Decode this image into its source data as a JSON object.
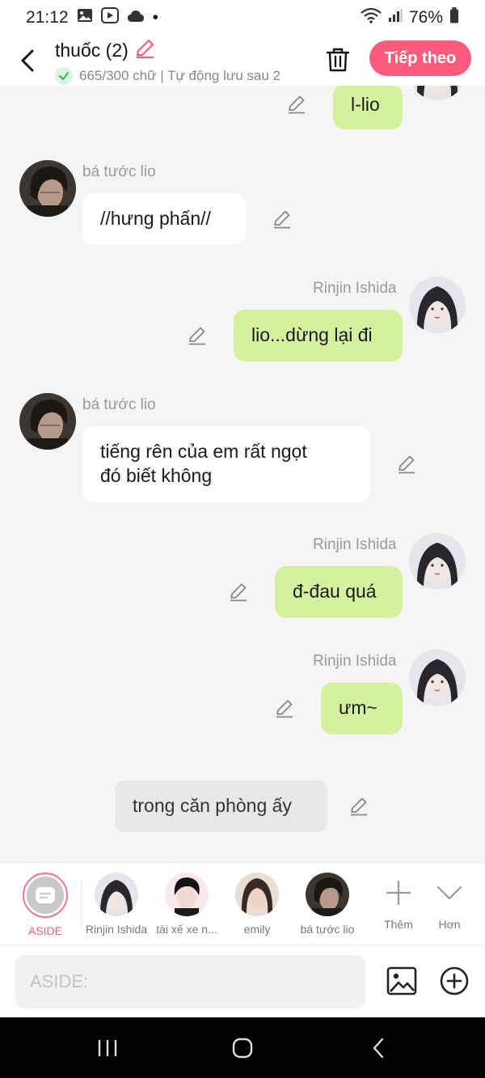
{
  "status_bar": {
    "time": "21:12",
    "dot": "•",
    "battery": "76%",
    "icons": [
      "gallery-icon",
      "video-icon",
      "cloud-icon",
      "wifi-icon",
      "signal-icon",
      "battery-icon"
    ]
  },
  "header": {
    "title": "thuốc (2)",
    "subtitle": "665/300 chữ | Tự động lưu sau 2",
    "next_label": "Tiếp theo",
    "accent": "#ff5b7d"
  },
  "chat": {
    "messages": [
      {
        "side": "right",
        "sender": "",
        "text": "l-lio"
      },
      {
        "side": "left",
        "sender": "bá tước lio",
        "text": "//hưng phấn//"
      },
      {
        "side": "right",
        "sender": "Rinjin Ishida",
        "text": "lio...dừng lại đi"
      },
      {
        "side": "left",
        "sender": "bá tước lio",
        "text_line1": "tiếng rên của em rất ngọt",
        "text_line2": "đó biết không"
      },
      {
        "side": "right",
        "sender": "Rinjin Ishida",
        "text": "đ-đau quá"
      },
      {
        "side": "right",
        "sender": "Rinjin Ishida",
        "text": "ưm~"
      },
      {
        "side": "narration",
        "text": "trong căn phòng ấy"
      }
    ],
    "bubble_right_color": "#d6f19e",
    "bubble_left_color": "#ffffff"
  },
  "characters": {
    "aside_label": "ASIDE",
    "items": [
      {
        "name": "Rinjin Ishida"
      },
      {
        "name": "tài xế xe n..."
      },
      {
        "name": "emily"
      },
      {
        "name": "bá tước lio"
      }
    ],
    "more_label": "Thêm",
    "expand_label": "Hơn"
  },
  "input": {
    "placeholder": "ASIDE:"
  }
}
